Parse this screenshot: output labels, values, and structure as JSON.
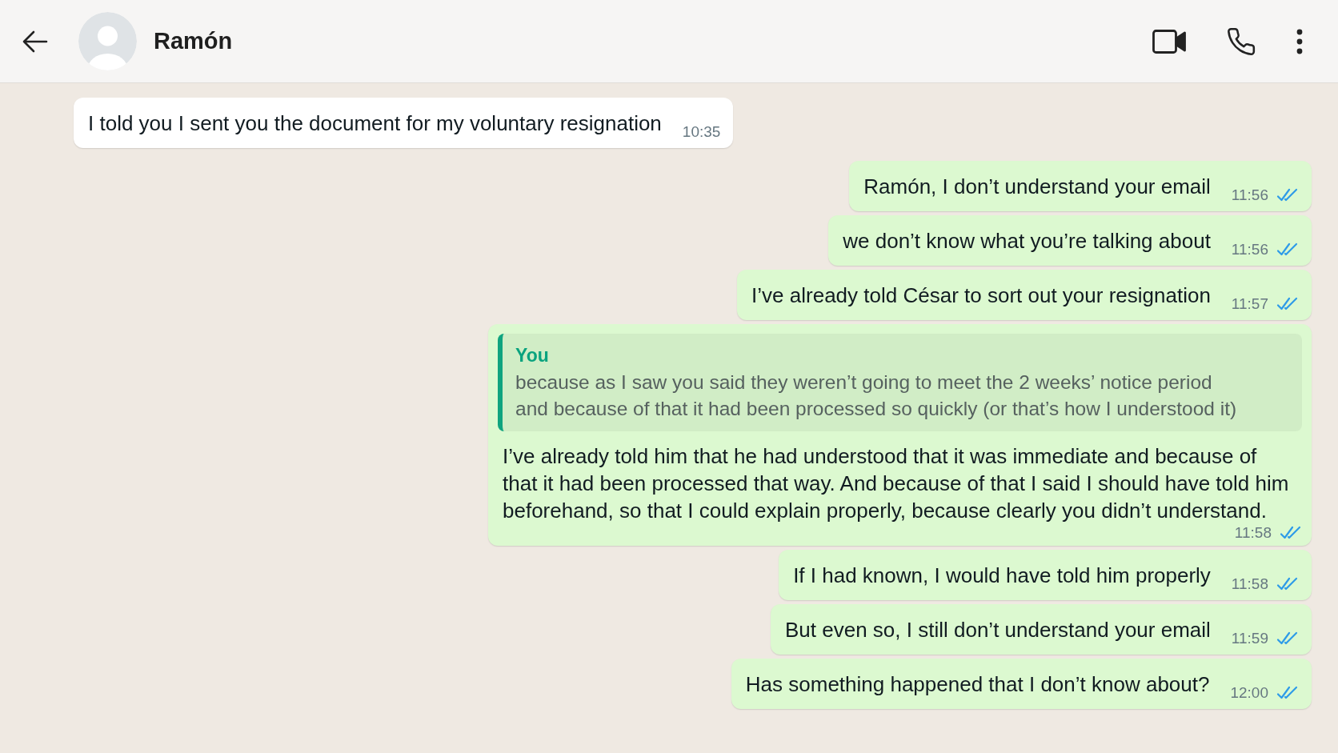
{
  "header": {
    "contact_name": "Ramón"
  },
  "messages": [
    {
      "kind": "incoming",
      "text": "I told you I sent you the document for my voluntary resignation",
      "time": "10:35"
    },
    {
      "kind": "outgoing",
      "text": "Ramón, I don’t understand your email",
      "time": "11:56",
      "read": true
    },
    {
      "kind": "outgoing",
      "text": "we don’t know what you’re talking about",
      "time": "11:56",
      "read": true
    },
    {
      "kind": "outgoing",
      "text": "I’ve already told César to sort out your resignation",
      "time": "11:57",
      "read": true
    },
    {
      "kind": "outgoing",
      "quote": {
        "author": "You",
        "text": "because as I saw you said they weren’t going to meet the 2 weeks’ notice period\nand because of that it had been processed so quickly (or that’s how I understood it)"
      },
      "text": "I’ve already told him that he had understood that it was immediate and because of that it had been processed that way. And because of that I said I should have told him beforehand, so that I could explain properly, because clearly you didn’t understand.",
      "time": "11:58",
      "read": true
    },
    {
      "kind": "outgoing",
      "text": "If I had known, I would have told him properly",
      "time": "11:58",
      "read": true
    },
    {
      "kind": "outgoing",
      "text": "But even so, I still don’t understand your email",
      "time": "11:59",
      "read": true
    },
    {
      "kind": "outgoing",
      "text": "Has something happened that I don’t know about?",
      "time": "12:00",
      "read": true
    }
  ]
}
